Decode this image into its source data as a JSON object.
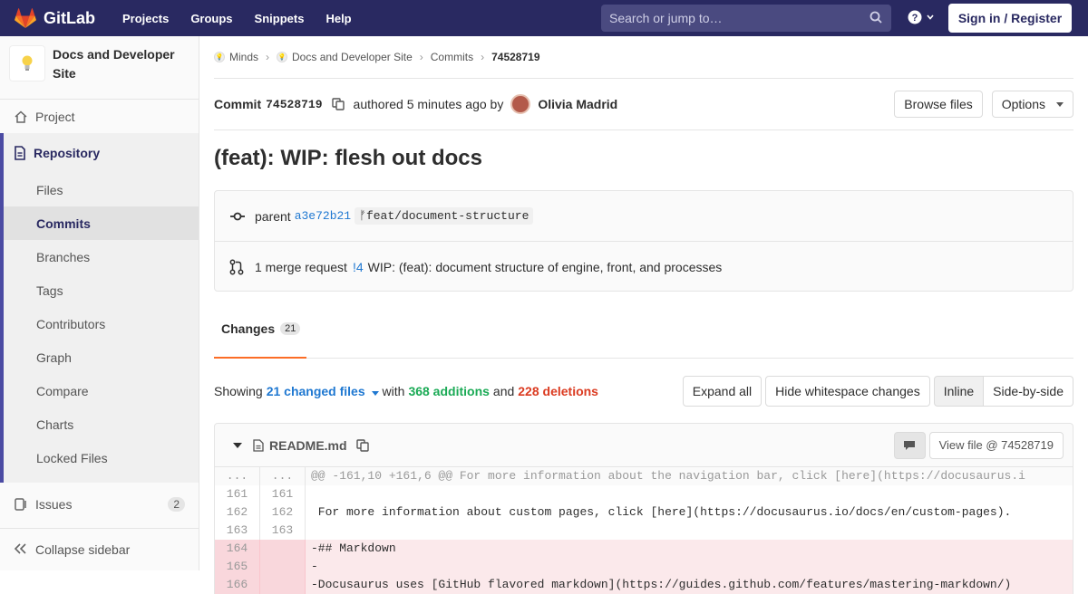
{
  "topbar": {
    "brand": "GitLab",
    "nav": [
      "Projects",
      "Groups",
      "Snippets",
      "Help"
    ],
    "search_placeholder": "Search or jump to…",
    "signin": "Sign in / Register"
  },
  "sidebar": {
    "project_line1": "Docs and Developer",
    "project_line2": "Site",
    "project": "Project",
    "repository": "Repository",
    "repo_items": [
      "Files",
      "Commits",
      "Branches",
      "Tags",
      "Contributors",
      "Graph",
      "Compare",
      "Charts",
      "Locked Files"
    ],
    "issues": "Issues",
    "issues_count": "2",
    "collapse": "Collapse sidebar"
  },
  "breadcrumb": {
    "group": "Minds",
    "project": "Docs and Developer Site",
    "section": "Commits",
    "current": "74528719"
  },
  "commit": {
    "label": "Commit",
    "sha": "74528719",
    "authored": "authored 5 minutes ago by",
    "author": "Olivia Madrid",
    "browse_files": "Browse files",
    "options": "Options",
    "title": "(feat): WIP: flesh out docs",
    "parent_label": "parent",
    "parent_sha": "a3e72b21",
    "branch": "feat/document-structure",
    "mr_label": "1 merge request",
    "mr_ref": "!4",
    "mr_title": "WIP: (feat): document structure of engine, front, and processes"
  },
  "tabs": {
    "changes": "Changes",
    "changes_count": "21"
  },
  "summary": {
    "showing": "Showing",
    "changed_files": "21 changed files",
    "with": "with",
    "additions": "368 additions",
    "and": "and",
    "deletions": "228 deletions",
    "expand_all": "Expand all",
    "hide_whitespace": "Hide whitespace changes",
    "inline": "Inline",
    "side_by_side": "Side-by-side"
  },
  "file": {
    "name": "README.md",
    "view_file": "View file @ 74528719"
  },
  "diff": [
    {
      "type": "meta",
      "old": "...",
      "new": "...",
      "text": "@@ -161,10 +161,6 @@ For more information about the navigation bar, click [here](https://docusaurus.i"
    },
    {
      "type": "ctx",
      "old": "161",
      "new": "161",
      "text": " "
    },
    {
      "type": "ctx",
      "old": "162",
      "new": "162",
      "text": " For more information about custom pages, click [here](https://docusaurus.io/docs/en/custom-pages)."
    },
    {
      "type": "ctx",
      "old": "163",
      "new": "163",
      "text": " "
    },
    {
      "type": "del",
      "old": "164",
      "new": "",
      "text": "-## Markdown"
    },
    {
      "type": "del",
      "old": "165",
      "new": "",
      "text": "-"
    },
    {
      "type": "del",
      "old": "166",
      "new": "",
      "text": "-Docusaurus uses [GitHub flavored markdown](https://guides.github.com/features/mastering-markdown/)"
    }
  ]
}
